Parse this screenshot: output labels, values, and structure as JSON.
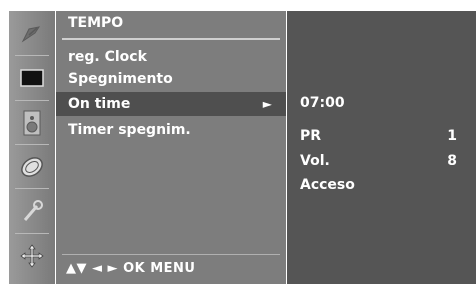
{
  "menu": {
    "title": "TEMPO",
    "items": [
      {
        "label": "reg. Clock",
        "selected": false
      },
      {
        "label": "Spegnimento",
        "selected": false
      },
      {
        "label": "On time",
        "selected": true
      },
      {
        "label": "Timer spegnim.",
        "selected": false
      }
    ],
    "arrow": "►",
    "hint": "▲▼  ◄ ►  OK  MENU"
  },
  "sidebar": {
    "icons": [
      "satellite-dish-icon",
      "screen-picture-icon",
      "speaker-audio-icon",
      "clock-time-icon",
      "key-lock-icon",
      "cross-arrows-icon"
    ]
  },
  "submenu": {
    "time": "07:00",
    "rows": [
      {
        "label": "PR",
        "value": "1"
      },
      {
        "label": "Vol.",
        "value": "8"
      }
    ],
    "status": "Acceso"
  },
  "colors": {
    "sidebar": "#8a8a8a",
    "menu_panel": "#7d7d7d",
    "selected_row": "#4f4f4f",
    "sub_panel": "#555555",
    "text": "#ffffff"
  }
}
